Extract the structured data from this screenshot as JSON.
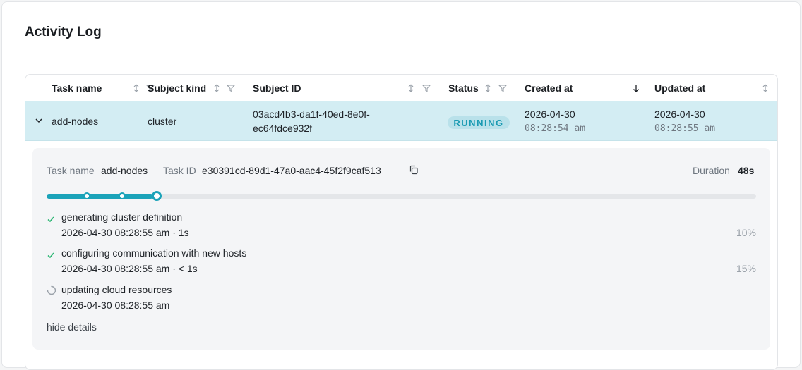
{
  "page": {
    "title": "Activity Log"
  },
  "table": {
    "columns": {
      "task_name": "Task name",
      "subject_kind": "Subject kind",
      "subject_id": "Subject ID",
      "status": "Status",
      "created_at": "Created at",
      "updated_at": "Updated at"
    },
    "row": {
      "task_name": "add-nodes",
      "subject_kind": "cluster",
      "subject_id_line1": "03acd4b3-da1f-40ed-8e0f-",
      "subject_id_line2": "ec64fdce932f",
      "status": "RUNNING",
      "created_date": "2026-04-30",
      "created_time": "08:28:54 am",
      "updated_date": "2026-04-30",
      "updated_time": "08:28:55 am"
    }
  },
  "details": {
    "task_name_label": "Task name",
    "task_name_value": "add-nodes",
    "task_id_label": "Task ID",
    "task_id_value": "e30391cd-89d1-47a0-aac4-45f2f9caf513",
    "duration_label": "Duration",
    "duration_value": "48s",
    "progress_percent": 15,
    "steps": [
      {
        "title": "generating cluster definition",
        "time": "2026-04-30 08:28:55 am",
        "duration": "1s",
        "percent": "10%",
        "state": "done"
      },
      {
        "title": "configuring communication with new hosts",
        "time": "2026-04-30 08:28:55 am",
        "duration": "< 1s",
        "percent": "15%",
        "state": "done"
      },
      {
        "title": "updating cloud resources",
        "time": "2026-04-30 08:28:55 am",
        "duration": "",
        "percent": "",
        "state": "running"
      }
    ],
    "hide_details": "hide details"
  },
  "colors": {
    "accent": "#1ba3b9",
    "row_highlight": "#d3edf3",
    "success": "#2bb673"
  },
  "icons": [
    "sort-icon",
    "filter-icon",
    "sort-desc-icon",
    "chevron-down-icon",
    "copy-icon",
    "check-icon",
    "spinner-icon"
  ]
}
